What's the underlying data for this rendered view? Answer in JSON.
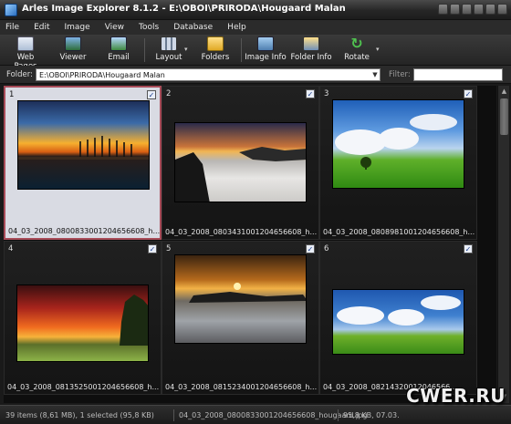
{
  "window": {
    "title": "Arles Image Explorer 8.1.2 - E:\\OBOI\\PRIRODA\\Hougaard Malan"
  },
  "menu": [
    "File",
    "Edit",
    "Image",
    "View",
    "Tools",
    "Database",
    "Help"
  ],
  "toolbar": {
    "web_pages": "Web Pages",
    "viewer": "Viewer",
    "email": "Email",
    "layout": "Layout",
    "folders": "Folders",
    "image_info": "Image Info",
    "folder_info": "Folder Info",
    "rotate": "Rotate"
  },
  "address": {
    "folder_label": "Folder:",
    "folder_value": "E:\\OBOI\\PRIRODA\\Hougaard Malan",
    "filter_label": "Filter:",
    "filter_value": ""
  },
  "thumbnails": [
    {
      "num": "1",
      "name": "04_03_2008_0800833001204656608_h...",
      "checked": "✓"
    },
    {
      "num": "2",
      "name": "04_03_2008_0803431001204656608_h...",
      "checked": "✓"
    },
    {
      "num": "3",
      "name": "04_03_2008_0808981001204656608_h...",
      "checked": "✓"
    },
    {
      "num": "4",
      "name": "04_03_2008_0813525001204656608_h...",
      "checked": "✓"
    },
    {
      "num": "5",
      "name": "04_03_2008_0815234001204656608_h...",
      "checked": "✓"
    },
    {
      "num": "6",
      "name": "04_03_2008_08214320012046566...",
      "checked": "✓"
    }
  ],
  "status": {
    "counts": "39 items (8,61 MB), 1 selected (95,8 KB)",
    "file": "04_03_2008_0800833001204656608_hougaard.jpg",
    "info": "95,8 KB, 07.03."
  },
  "watermark": "CWER.RU",
  "colors": {
    "selected_border": "#a84b58",
    "selected_bg": "#d9dbe3",
    "grid_bg": "#0e0e0e"
  }
}
